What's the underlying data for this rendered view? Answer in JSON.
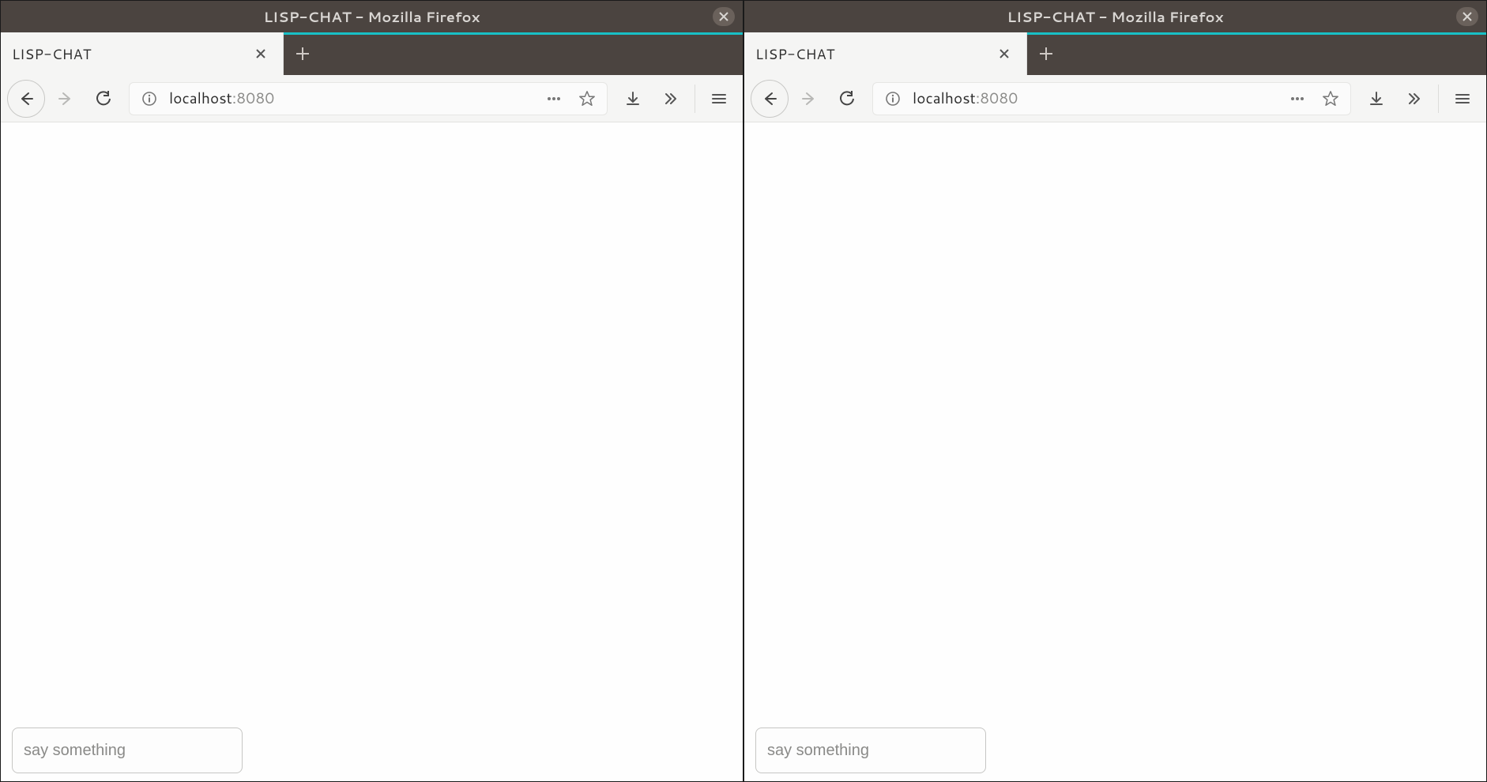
{
  "windows": [
    {
      "title": "LISP-CHAT - Mozilla Firefox",
      "tab": {
        "title": "LISP-CHAT"
      },
      "url": {
        "host": "localhost",
        "port": ":8080"
      },
      "input": {
        "placeholder": "say something",
        "value": ""
      }
    },
    {
      "title": "LISP-CHAT - Mozilla Firefox",
      "tab": {
        "title": "LISP-CHAT"
      },
      "url": {
        "host": "localhost",
        "port": ":8080"
      },
      "input": {
        "placeholder": "say something",
        "value": ""
      }
    }
  ]
}
